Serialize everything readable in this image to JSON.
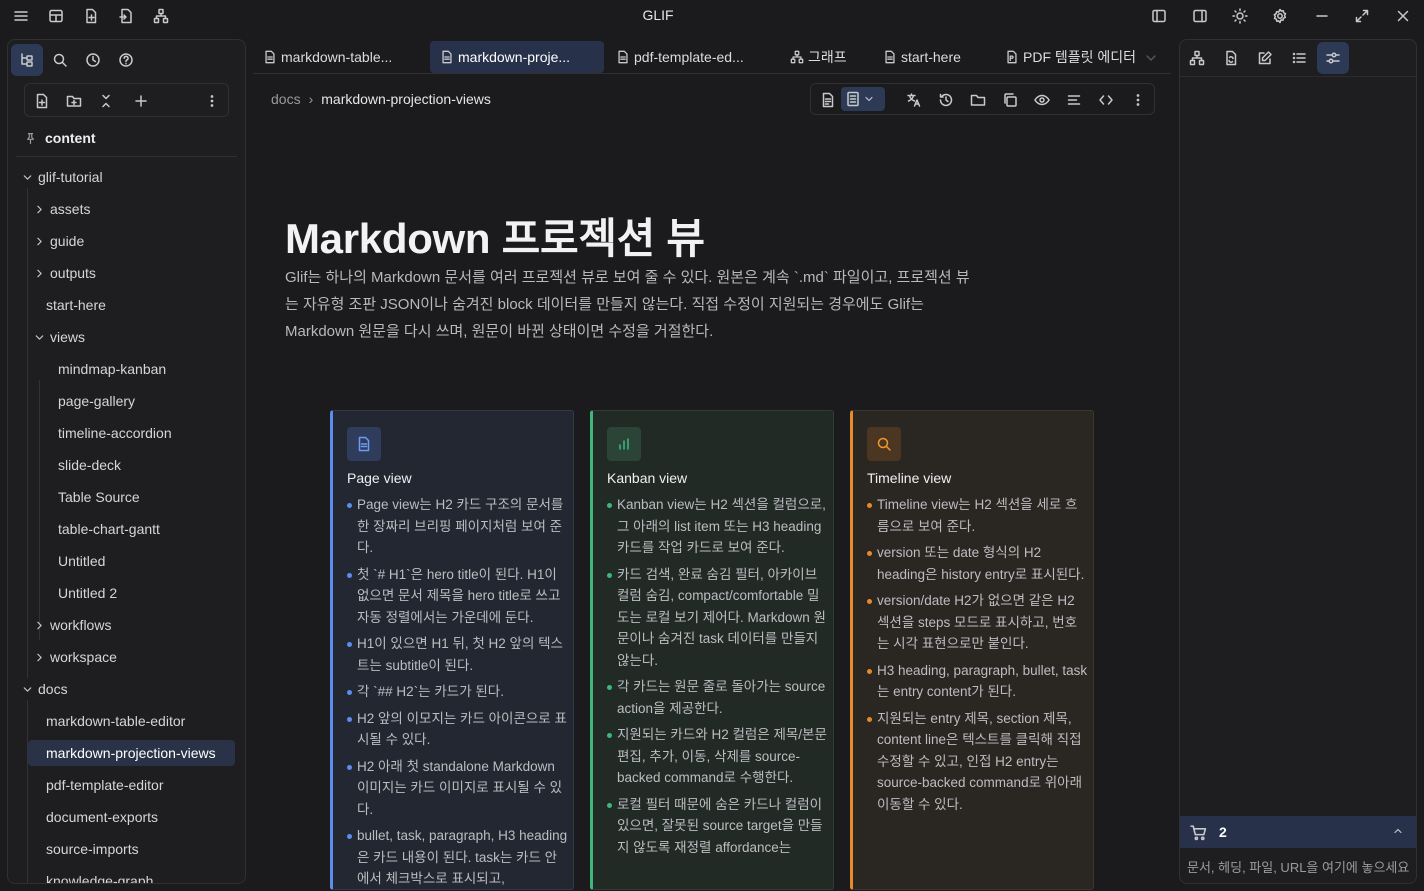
{
  "app": {
    "title": "GLIF"
  },
  "sidebar": {
    "root_label": "content",
    "tree": [
      {
        "label": "glif-tutorial",
        "depth": 0,
        "chevron": "down"
      },
      {
        "label": "assets",
        "depth": 1,
        "chevron": "right"
      },
      {
        "label": "guide",
        "depth": 1,
        "chevron": "right"
      },
      {
        "label": "outputs",
        "depth": 1,
        "chevron": "right"
      },
      {
        "label": "start-here",
        "depth": 1,
        "chevron": ""
      },
      {
        "label": "views",
        "depth": 1,
        "chevron": "down"
      },
      {
        "label": "mindmap-kanban",
        "depth": 2,
        "chevron": ""
      },
      {
        "label": "page-gallery",
        "depth": 2,
        "chevron": ""
      },
      {
        "label": "timeline-accordion",
        "depth": 2,
        "chevron": ""
      },
      {
        "label": "slide-deck",
        "depth": 2,
        "chevron": ""
      },
      {
        "label": "Table Source",
        "depth": 2,
        "chevron": ""
      },
      {
        "label": "table-chart-gantt",
        "depth": 2,
        "chevron": ""
      },
      {
        "label": "Untitled",
        "depth": 2,
        "chevron": ""
      },
      {
        "label": "Untitled 2",
        "depth": 2,
        "chevron": ""
      },
      {
        "label": "workflows",
        "depth": 1,
        "chevron": "right"
      },
      {
        "label": "workspace",
        "depth": 1,
        "chevron": "right"
      },
      {
        "label": "docs",
        "depth": 0,
        "chevron": "down"
      },
      {
        "label": "markdown-table-editor",
        "depth": 1,
        "chevron": ""
      },
      {
        "label": "markdown-projection-views",
        "depth": 1,
        "chevron": "",
        "selected": true
      },
      {
        "label": "pdf-template-editor",
        "depth": 1,
        "chevron": ""
      },
      {
        "label": "document-exports",
        "depth": 1,
        "chevron": ""
      },
      {
        "label": "source-imports",
        "depth": 1,
        "chevron": ""
      },
      {
        "label": "knowledge-graph",
        "depth": 1,
        "chevron": ""
      }
    ]
  },
  "tabs": [
    {
      "label": "markdown-table...",
      "icon": "file-icon"
    },
    {
      "label": "markdown-proje...",
      "icon": "file-icon",
      "active": true
    },
    {
      "label": "pdf-template-ed...",
      "icon": "file-icon"
    },
    {
      "label": "그래프",
      "icon": "graph-icon"
    },
    {
      "label": "start-here",
      "icon": "file-icon"
    },
    {
      "label": "PDF 템플릿 에디터",
      "icon": "pdf-icon"
    }
  ],
  "breadcrumb": {
    "parent": "docs",
    "separator": "›",
    "current": "markdown-projection-views"
  },
  "document": {
    "title": "Markdown 프로젝션 뷰",
    "subtitle": "Glif는 하나의 Markdown 문서를 여러 프로젝션 뷰로 보여 줄 수 있다. 원본은 계속 `.md` 파일이고, 프로젝션 뷰는 자유형 조판 JSON이나 숨겨진 block 데이터를 만들지 않는다. 직접 수정이 지원되는 경우에도 Glif는 Markdown 원문을 다시 쓰며, 원문이 바뀐 상태이면 수정을 거절한다.",
    "cards": [
      {
        "key": "page",
        "title": "Page view",
        "icon": "document-icon",
        "accent": "#5b8def",
        "items": [
          "Page view는 H2 카드 구조의 문서를 한 장짜리 브리핑 페이지처럼 보여 준다.",
          "첫 `# H1`은 hero title이 된다. H1이 없으면 문서 제목을 hero title로 쓰고 자동 정렬에서는 가운데에 둔다.",
          "H1이 있으면 H1 뒤, 첫 H2 앞의 텍스트는 subtitle이 된다.",
          "각 `## H2`는 카드가 된다.",
          "H2 앞의 이모지는 카드 아이콘으로 표시될 수 있다.",
          "H2 아래 첫 standalone Markdown 이미지는 카드 이미지로 표시될 수 있다.",
          "bullet, task, paragraph, H3 heading은 카드 내용이 된다. task는 카드 안에서 체크박스로 표시되고,"
        ]
      },
      {
        "key": "kanban",
        "title": "Kanban view",
        "icon": "bar-chart-icon",
        "accent": "#3fb67a",
        "items": [
          "Kanban view는 H2 섹션을 컬럼으로, 그 아래의 list item 또는 H3 heading 카드를 작업 카드로 보여 준다.",
          "카드 검색, 완료 숨김 필터, 아카이브 컬럼 숨김, compact/comfortable 밀도는 로컬 보기 제어다. Markdown 원문이나 숨겨진 task 데이터를 만들지 않는다.",
          "각 카드는 원문 줄로 돌아가는 source action을 제공한다.",
          "지원되는 카드와 H2 컬럼은 제목/본문 편집, 추가, 이동, 삭제를 source-backed command로 수행한다.",
          "로컬 필터 때문에 숨은 카드나 컬럼이 있으면, 잘못된 source target을 만들지 않도록 재정렬 affordance는"
        ]
      },
      {
        "key": "timeline",
        "title": "Timeline view",
        "icon": "search-icon",
        "accent": "#e68a2a",
        "items": [
          "Timeline view는 H2 섹션을 세로 흐름으로 보여 준다.",
          "version 또는 date 형식의 H2 heading은 history entry로 표시된다.",
          "version/date H2가 없으면 같은 H2 섹션을 steps 모드로 표시하고, 번호는 시각 표현으로만 붙인다.",
          "H3 heading, paragraph, bullet, task는 entry content가 된다.",
          "지원되는 entry 제목, section 제목, content line은 텍스트를 클릭해 직접 수정할 수 있고, 인접 H2 entry는 source-backed command로 위아래 이동할 수 있다."
        ]
      }
    ]
  },
  "right_panel": {
    "cart_count": "2",
    "drop_hint": "문서, 헤딩, 파일, URL을 여기에 놓으세요"
  }
}
